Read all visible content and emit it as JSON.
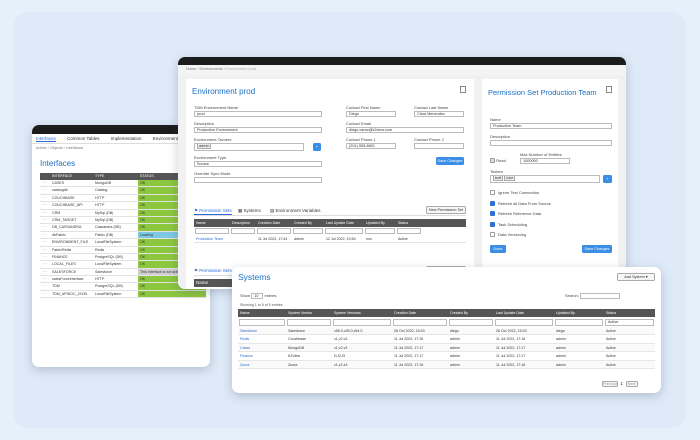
{
  "interfaces": {
    "tabs": [
      "Interfaces",
      "Common Tables",
      "Implementation",
      "Environments"
    ],
    "breadcrumb": [
      "Admin",
      "Objects",
      "Interfaces"
    ],
    "title": "Interfaces",
    "headers": [
      "INTERFACE",
      "TYPE",
      "STATUS"
    ],
    "rows": [
      {
        "name": "CASES",
        "type": "MongoDB",
        "status": "OK"
      },
      {
        "name": "catalogdb",
        "type": "Catalog",
        "status": "OK"
      },
      {
        "name": "COUCHBASE",
        "type": "HTTP",
        "status": "OK"
      },
      {
        "name": "COUCHBASE_API",
        "type": "HTTP",
        "status": "OK"
      },
      {
        "name": "CRM",
        "type": "MySql (DB)",
        "status": "OK"
      },
      {
        "name": "CRM_TARGET",
        "type": "MySql (DB)",
        "status": "OK"
      },
      {
        "name": "DB_CASSANDRA",
        "type": "Cassandra (DB)",
        "status": "OK"
      },
      {
        "name": "dbFabric",
        "type": "Fabric (DB)",
        "status": "Loading"
      },
      {
        "name": "ENVIRONMENT_FILE",
        "type": "LocalFileSystem",
        "status": "OK"
      },
      {
        "name": "FabricRedis",
        "type": "Redis",
        "status": "OK"
      },
      {
        "name": "FINANCE",
        "type": "PostgreSQL (DB)",
        "status": "OK"
      },
      {
        "name": "LOCAL_FILES",
        "type": "LocalFileSystem",
        "status": "OK"
      },
      {
        "name": "SALESFORCE",
        "type": "Salesforce",
        "status": "This interface is not active in this environment"
      },
      {
        "name": "salesForceInterface",
        "type": "HTTP",
        "status": "OK"
      },
      {
        "name": "TDM",
        "type": "PostgreSQL (DB)",
        "status": "OK"
      },
      {
        "name": "TDM_APIDOC_JSON",
        "type": "LocalFileSystem",
        "status": "OK"
      }
    ],
    "colors": {
      "ok": "#8dc63f",
      "loading": "#7ec8e3",
      "inactive": "#cfcfcf",
      "header": "#555555"
    }
  },
  "env": {
    "breadcrumb": [
      "Home",
      "Environments",
      "Environment prod"
    ],
    "title": "Environment prod",
    "tdm_name_label": "TDM Environment Name",
    "tdm_name_value": "prod",
    "description_label": "Description",
    "description_value": "Production Environment",
    "owners_label": "Environment Owners",
    "owners_value": "admin",
    "type_label": "Environment Type",
    "type_value": "Source",
    "sync_label": "Override Sync Mode",
    "contact_first_label": "Contact First Name",
    "contact_first_value": "Diego",
    "contact_last_label": "Contact Last Name",
    "contact_last_value": "Clara Menendez",
    "contact_email_label": "Contact Email",
    "contact_email_value": "diego.carac@k2view.com",
    "phone1_label": "Contact Phone 1",
    "phone1_value": "(201) 555-8801",
    "phone2_label": "Contact Phone 2",
    "save_label": "Save Changes",
    "tabs": [
      "Permission Sets",
      "Systems",
      "Environment Variables"
    ],
    "new_perm_label": "New Permission Set",
    "perm_headers": [
      "Name",
      "Description",
      "Creation Date",
      "Created By",
      "Last Update Date",
      "Updated By",
      "Status"
    ],
    "perm_row": [
      "Production Team",
      "",
      "11 Jul 2022, 17:44",
      "admin",
      "12 Jul 2022, 10:54",
      "non",
      "Active"
    ],
    "second_tab": "Permission Sets",
    "second_name_header": "Name"
  },
  "perm": {
    "title": "Permission Set Production Team",
    "name_label": "Name",
    "name_value": "Production Team",
    "description_label": "Description",
    "read_label": "Read",
    "max_label": "Max Number of Entities",
    "max_value": "1000000",
    "testers_label": "Testers",
    "testers_value": [
      "tedf",
      "luke"
    ],
    "options": [
      {
        "label": "Ignore Test Connection",
        "checked": false
      },
      {
        "label": "Refresh all Data From Source",
        "checked": true
      },
      {
        "label": "Refresh Reference Data",
        "checked": true
      },
      {
        "label": "Task Scheduling",
        "checked": true
      },
      {
        "label": "Data Versioning",
        "checked": false
      }
    ],
    "done_label": "Done",
    "save_label": "Save Changes"
  },
  "systems": {
    "title": "Systems",
    "add_label": "Add System",
    "show_label": "Show",
    "show_value": "10",
    "entries_label": "entries",
    "search_label": "Search:",
    "showing": "Showing 1 to 5 of 5 entries",
    "headers": [
      "Name",
      "System Vendor",
      "System Versions",
      "Creation Date",
      "Created By",
      "Last Update Date",
      "Updated By",
      "Status"
    ],
    "status_filter": "Active",
    "rows": [
      [
        "Salesforce",
        "Salesforce",
        "v56.0,v55.0,v54.0",
        "26 Oct 2022, 15:03",
        "diego",
        "26 Oct 2022, 15:03",
        "diego",
        "Active"
      ],
      [
        "Redis",
        "Couchbase",
        "v1,v2,v3",
        "11 Jul 2022, 17:16",
        "admin",
        "11 Jul 2022, 17:16",
        "admin",
        "Active"
      ],
      [
        "Cases",
        "MongoDB",
        "v1,v2,v3",
        "11 Jul 2022, 17:17",
        "admin",
        "11 Jul 2022, 17:17",
        "admin",
        "Active"
      ],
      [
        "Finance",
        "K2View",
        "f1,f2,f3",
        "11 Jul 2022, 17:17",
        "admin",
        "11 Jul 2022, 17:17",
        "admin",
        "Active"
      ],
      [
        "Zuora",
        "Zuora",
        "z1,z2,z3",
        "11 Jul 2022, 17:16",
        "admin",
        "11 Jul 2022, 17:16",
        "admin",
        "Active"
      ]
    ],
    "pager": [
      "Previous",
      "1",
      "Next"
    ]
  }
}
